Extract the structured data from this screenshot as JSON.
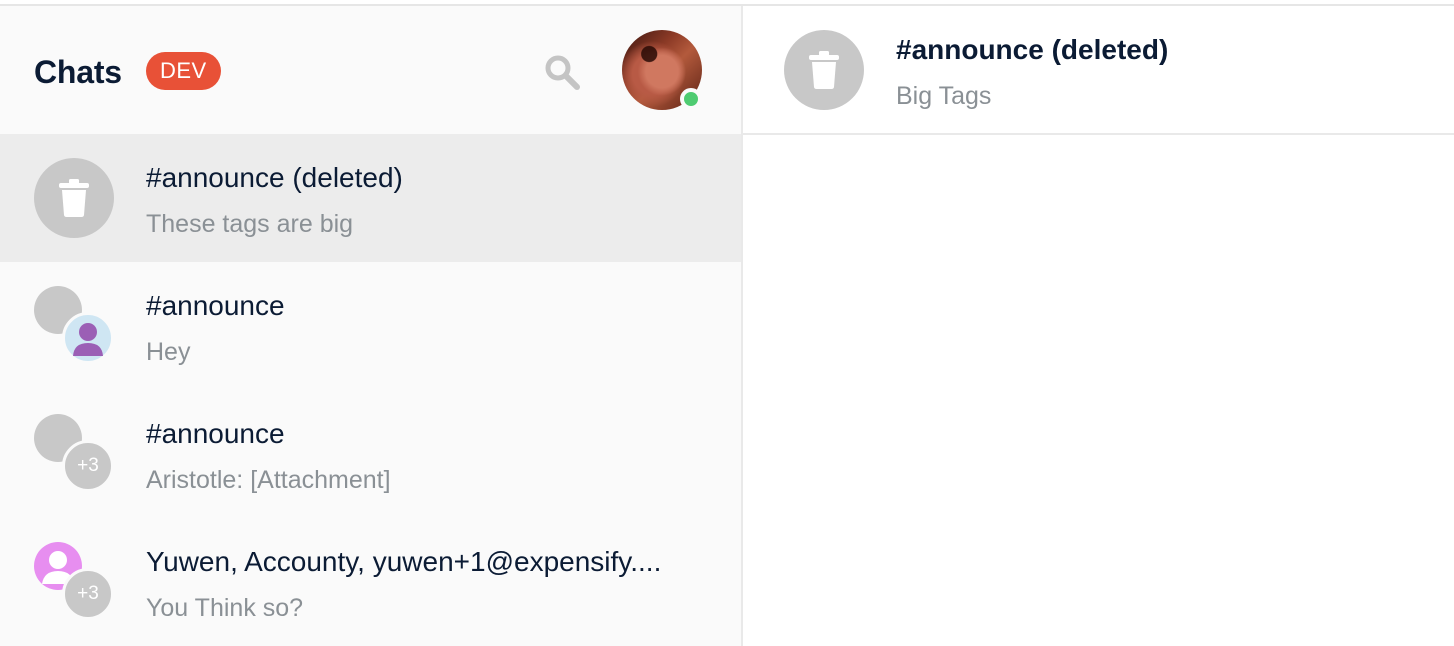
{
  "sidebar": {
    "title": "Chats",
    "badge": "DEV",
    "search_icon": "search-icon",
    "profile": {
      "status": "online",
      "status_color": "#4ecb71"
    },
    "chats": [
      {
        "name": "#announce (deleted)",
        "preview": "These tags are big",
        "avatar": "trash-icon",
        "active": true
      },
      {
        "name": "#announce",
        "preview": "Hey",
        "avatar": "person-icon"
      },
      {
        "name": "#announce",
        "preview": "Aristotle: [Attachment]",
        "avatar_count": "+3"
      },
      {
        "name": "Yuwen, Accounty, yuwen+1@expensify....",
        "preview": "You Think so?",
        "avatar_count": "+3"
      }
    ]
  },
  "main": {
    "title": "#announce (deleted)",
    "subtitle": "Big Tags",
    "avatar": "trash-icon"
  },
  "colors": {
    "badge": "#e85137",
    "text_primary": "#0b1b34",
    "text_secondary": "#8a9095",
    "active_row": "#ececec",
    "avatar_grey": "#c8c8c8"
  }
}
